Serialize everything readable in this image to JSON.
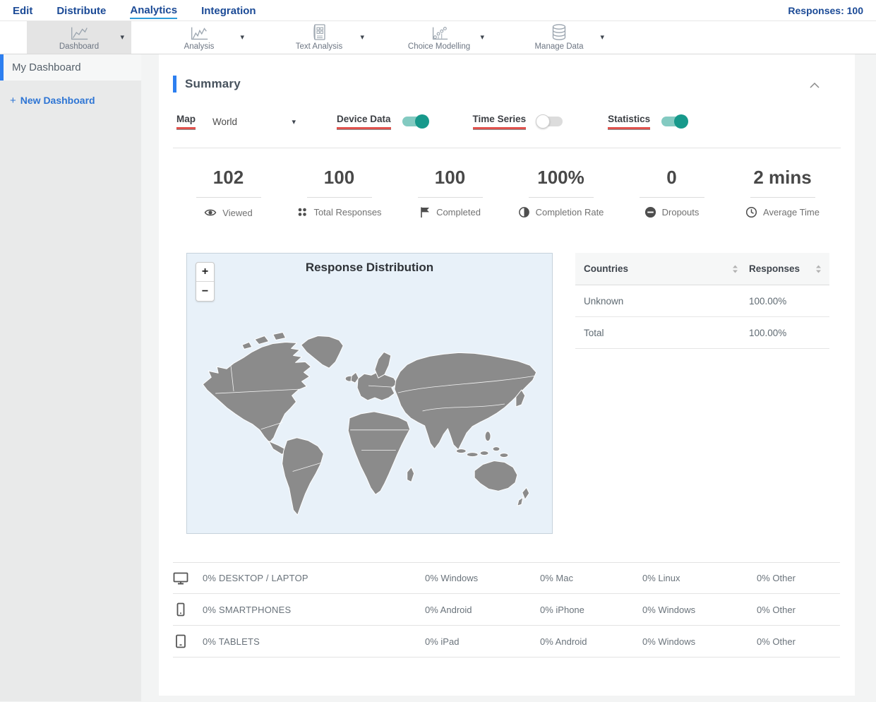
{
  "nav": {
    "items": [
      {
        "label": "Edit"
      },
      {
        "label": "Distribute"
      },
      {
        "label": "Analytics",
        "active": true
      },
      {
        "label": "Integration"
      }
    ],
    "responses_label": "Responses: 100"
  },
  "toolbar": {
    "caret": "▾",
    "items": [
      {
        "label": "Dashboard",
        "icon": "line-chart-icon",
        "selected": true
      },
      {
        "label": "Analysis",
        "icon": "line-chart-icon"
      },
      {
        "label": "Text Analysis",
        "icon": "document-grid-icon"
      },
      {
        "label": "Choice Modelling",
        "icon": "scatter-line-icon"
      },
      {
        "label": "Manage Data",
        "icon": "database-icon"
      }
    ]
  },
  "sidebar": {
    "selected_item": "My Dashboard",
    "plus_label": "+",
    "new_dashboard_label": "New Dashboard"
  },
  "summary": {
    "title": "Summary",
    "controls": {
      "map_label": "Map",
      "map_value": "World",
      "device_data_label": "Device Data",
      "device_data_on": true,
      "time_series_label": "Time Series",
      "time_series_on": false,
      "statistics_label": "Statistics",
      "statistics_on": true
    },
    "stats": [
      {
        "value": "102",
        "label": "Viewed",
        "icon": "eye-icon"
      },
      {
        "value": "100",
        "label": "Total Responses",
        "icon": "dots-grid-icon"
      },
      {
        "value": "100",
        "label": "Completed",
        "icon": "flag-icon"
      },
      {
        "value": "100%",
        "label": "Completion Rate",
        "icon": "half-circle-icon"
      },
      {
        "value": "0",
        "label": "Dropouts",
        "icon": "minus-circle-icon"
      },
      {
        "value": "2 mins",
        "label": "Average Time",
        "icon": "clock-icon"
      }
    ],
    "map": {
      "title": "Response Distribution",
      "zoom_in_label": "+",
      "zoom_out_label": "−"
    },
    "countries_table": {
      "col1_header": "Countries",
      "col2_header": "Responses",
      "rows": [
        {
          "country": "Unknown",
          "responses": "100.00%"
        },
        {
          "country": "Total",
          "responses": "100.00%"
        }
      ]
    },
    "device_table": {
      "rows": [
        {
          "icon": "desktop-icon",
          "device": "0% DESKTOP / LAPTOP",
          "col2": "0% Windows",
          "col3": "0% Mac",
          "col4": "0% Linux",
          "col5": "0% Other"
        },
        {
          "icon": "smartphone-icon",
          "device": "0% SMARTPHONES",
          "col2": "0% Android",
          "col3": "0% iPhone",
          "col4": "0% Windows",
          "col5": "0% Other"
        },
        {
          "icon": "tablet-icon",
          "device": "0% TABLETS",
          "col2": "0% iPad",
          "col3": "0% Android",
          "col4": "0% Windows",
          "col5": "0% Other"
        }
      ]
    }
  },
  "colors": {
    "nav_blue": "#1b4a96",
    "active_underline": "#2d9cdb",
    "accent_blue": "#2d7ff0",
    "red_underline": "#e0514c",
    "toggle_on": "#17998b",
    "toggle_on_track": "#83cac1",
    "map_background": "#e8f1f9",
    "map_land": "#8b8b8b"
  }
}
